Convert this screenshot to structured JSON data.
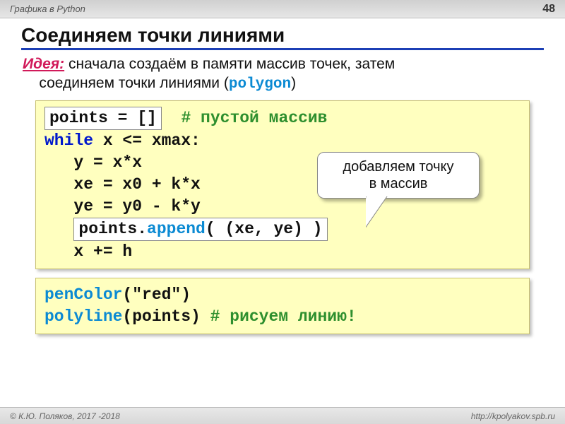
{
  "topbar": {
    "title": "Графика в Python",
    "pagenum": "48"
  },
  "heading": "Соединяем точки линиями",
  "idea": {
    "label": "Идея:",
    "text1": "сначала создаём в памяти массив точек, затем",
    "text2": "соединяем точки линиями (",
    "poly": "polygon",
    "text3": ")"
  },
  "code1": {
    "l1_box": "points = []",
    "l1_comment": "# пустой массив",
    "l2_kw": "while",
    "l2_rest": " x <= xmax:",
    "l3": "   y = x*x",
    "l4": "   xe = x0 + k*x",
    "l5": "   ye = y0 - k*y",
    "l6_pre": "   ",
    "l6_box_a": "points.",
    "l6_box_fn": "append",
    "l6_box_b": "( (xe, ye) )",
    "l7": "   x += h"
  },
  "callout": {
    "line1": "добавляем точку",
    "line2": "в массив"
  },
  "code2": {
    "l1_fn": "penColor",
    "l1_rest": "(\"red\")",
    "l2_fn": "polyline",
    "l2_rest": "(points) ",
    "l2_comment": "# рисуем линию!"
  },
  "footer": {
    "left": "© К.Ю. Поляков, 2017 -2018",
    "right": "http://kpolyakov.spb.ru"
  }
}
